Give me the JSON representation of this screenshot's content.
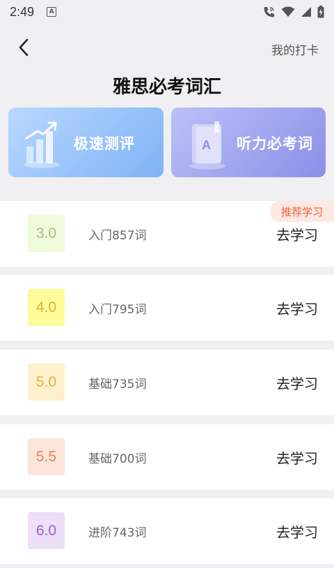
{
  "status_bar": {
    "time": "2:49",
    "notif_badge": "A",
    "icons": [
      "phone-wifi-call-icon",
      "wifi-icon",
      "signal-icon",
      "battery-charging-icon"
    ]
  },
  "header": {
    "back_icon": "chevron-left-icon",
    "checkin_label": "我的打卡",
    "title": "雅思必考词汇"
  },
  "feature_cards": [
    {
      "label": "极速测评",
      "icon": "bar-chart-arrow-icon",
      "colors": [
        "#b9d8ff",
        "#7fb3f5"
      ]
    },
    {
      "label": "听力必考词",
      "icon": "book-a-icon",
      "colors": [
        "#bcc0f8",
        "#8a90e8"
      ]
    }
  ],
  "levels": [
    {
      "score": "3.0",
      "desc": "入门857词",
      "action": "去学习",
      "badge_bg": "#eefad9",
      "badge_color": "#a7bd86",
      "tag": "推荐学习"
    },
    {
      "score": "4.0",
      "desc": "入门795词",
      "action": "去学习",
      "badge_bg": "#fdfb9a",
      "badge_color": "#d8b526"
    },
    {
      "score": "5.0",
      "desc": "基础735词",
      "action": "去学习",
      "badge_bg": "#fdf0cd",
      "badge_color": "#e6b43f"
    },
    {
      "score": "5.5",
      "desc": "基础700词",
      "action": "去学习",
      "badge_bg": "#fbe5da",
      "badge_color": "#e7835e"
    },
    {
      "score": "6.0",
      "desc": "进阶743词",
      "action": "去学习",
      "badge_bg": "#ecdff7",
      "badge_color": "#9a5fcf"
    }
  ]
}
